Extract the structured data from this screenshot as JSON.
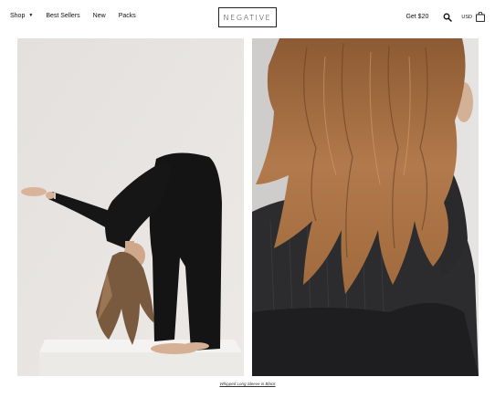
{
  "nav": {
    "items": [
      {
        "label": "Shop"
      },
      {
        "label": "Best Sellers"
      },
      {
        "label": "New"
      },
      {
        "label": "Packs"
      }
    ]
  },
  "logo": {
    "text": "NEGATIVE"
  },
  "header_right": {
    "promo": "Get $20",
    "currency": "USD"
  },
  "caption": {
    "text": "Whipped Long Sleeve in Black"
  },
  "icons": [
    "chevron-down-icon",
    "search-icon",
    "shopping-bag-icon"
  ],
  "colors": {
    "background": "#ffffff",
    "text": "#111111",
    "garment": "#141414"
  }
}
